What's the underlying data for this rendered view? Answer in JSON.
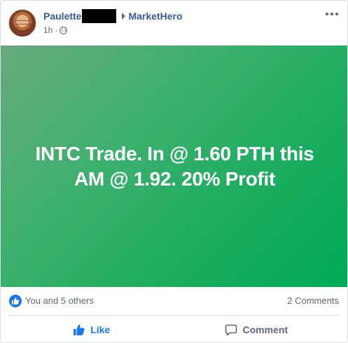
{
  "post": {
    "author": "Paulette",
    "group": "MarketHero",
    "time": "1h",
    "body": "INTC Trade. In @ 1.60 PTH this AM @ 1.92. 20% Profit",
    "hero_colors": {
      "start": "#67aa7c",
      "end": "#00ab58"
    }
  },
  "stats": {
    "reactions": "You and 5 others",
    "comments": "2 Comments"
  },
  "actions": {
    "like": "Like",
    "comment": "Comment"
  },
  "icons": {
    "avatar": "profile-photo",
    "arrow": "caret-right-icon",
    "privacy": "globe-icon",
    "more": "more-options-icon",
    "reaction": "thumbs-up-reaction-icon",
    "like": "thumbs-up-icon",
    "comment": "speech-bubble-icon"
  },
  "colors": {
    "link": "#385898",
    "accent": "#1877f2",
    "muted": "#606770"
  }
}
